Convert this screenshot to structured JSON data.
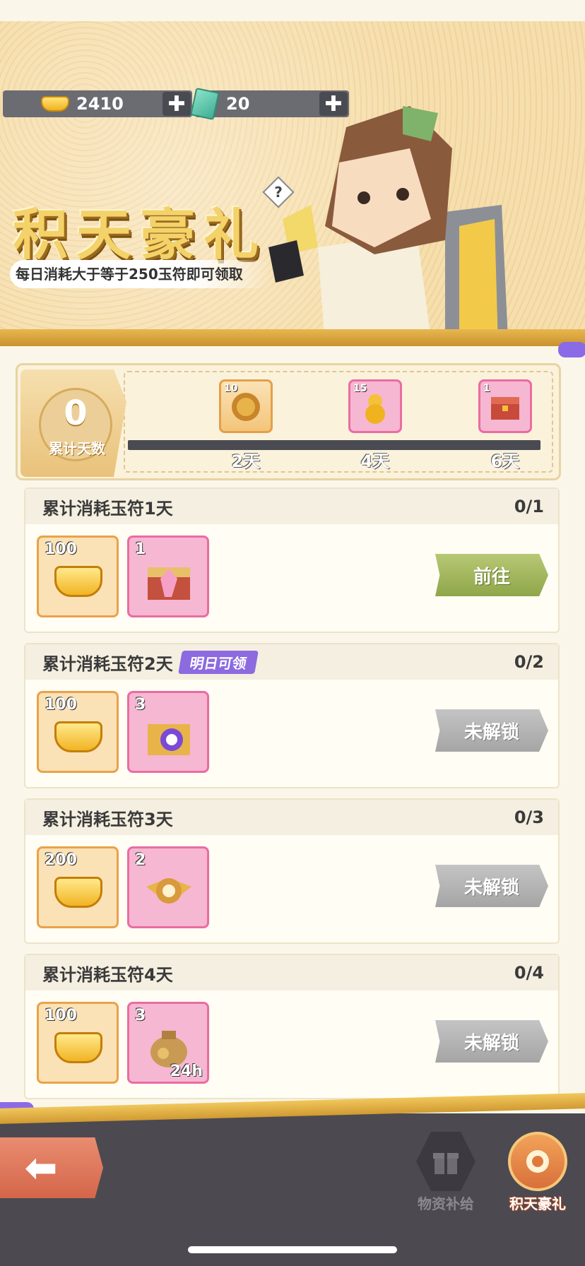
{
  "currency": {
    "gold_icon": "gold-ingot-icon",
    "gold_value": "2410",
    "ticket_icon": "jade-ticket-icon",
    "ticket_value": "20",
    "plus": "✚"
  },
  "banner": {
    "title": "积天豪礼",
    "help": "?",
    "subtitle": "每日消耗大于等于250玉符即可领取"
  },
  "progress": {
    "days_count": "0",
    "days_label": "累计天数",
    "milestones": [
      {
        "qty": "10",
        "label": "2天",
        "icon": "general-token-icon"
      },
      {
        "qty": "15",
        "label": "4天",
        "icon": "gold-gourd-icon"
      },
      {
        "qty": "1",
        "label": "6天",
        "icon": "red-chest-icon"
      }
    ]
  },
  "tasks": [
    {
      "title": "累计消耗玉符1天",
      "progress": "0/1",
      "badge": "",
      "rewards": [
        {
          "qty": "100",
          "icon": "gold-ingot-icon"
        },
        {
          "qty": "1",
          "icon": "crystal-chest-icon"
        }
      ],
      "action": "前往",
      "state": "go"
    },
    {
      "title": "累计消耗玉符2天",
      "progress": "0/2",
      "badge": "明日可领",
      "rewards": [
        {
          "qty": "100",
          "icon": "gold-ingot-icon"
        },
        {
          "qty": "3",
          "icon": "general-chest-icon"
        }
      ],
      "action": "未解锁",
      "state": "locked"
    },
    {
      "title": "累计消耗玉符3天",
      "progress": "0/3",
      "badge": "",
      "rewards": [
        {
          "qty": "200",
          "icon": "gold-ingot-icon"
        },
        {
          "qty": "2",
          "icon": "winged-emblem-icon"
        }
      ],
      "action": "未解锁",
      "state": "locked"
    },
    {
      "title": "累计消耗玉符4天",
      "progress": "0/4",
      "badge": "",
      "rewards": [
        {
          "qty": "100",
          "icon": "gold-ingot-icon"
        },
        {
          "qty": "3",
          "icon": "coin-bag-24h-icon"
        }
      ],
      "action": "未解锁",
      "state": "locked"
    }
  ],
  "coin_bag_tag": "24h",
  "bottom_nav": {
    "back": "⬅",
    "supply_label": "物资补给",
    "supply_icon": "gift-icon",
    "active_label": "积天豪礼",
    "active_icon": "gold-gift-icon"
  },
  "colors": {
    "accent_gold": "#e8b74f",
    "go_green": "#9bb158",
    "locked_gray": "#b5b5b5",
    "badge_purple": "#8c6ae0"
  }
}
